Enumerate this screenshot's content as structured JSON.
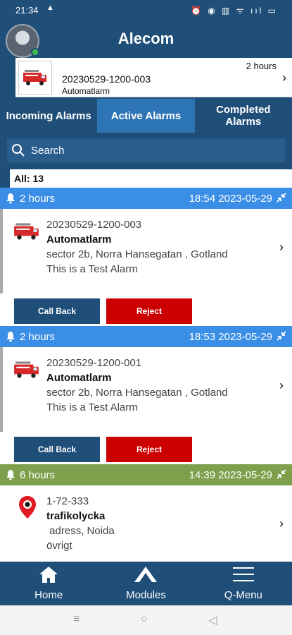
{
  "status": {
    "time": "21:34",
    "icons": "⏰ ◉ ▥ ᯤ ııl ▭"
  },
  "app": {
    "title": "Alecom"
  },
  "banner": {
    "id": "20230529-1200-003",
    "type": "Automatlarm",
    "time": "2 hours"
  },
  "tabs": [
    "Incoming Alarms",
    "Active Alarms",
    "Completed Alarms"
  ],
  "search": {
    "placeholder": "Search"
  },
  "count": "All: 13",
  "alarms": [
    {
      "age": "2 hours",
      "timestamp": "18:54 2023-05-29",
      "id": "20230529-1200-003",
      "type": "Automatlarm",
      "address": "sector 2b, Norra Hansegatan , Gotland",
      "note": "This is a Test Alarm",
      "header_color": "#3a8ee6",
      "icon": "fire-truck-icon",
      "call_label": "Call Back",
      "reject_label": "Reject"
    },
    {
      "age": "2 hours",
      "timestamp": "18:53 2023-05-29",
      "id": "20230529-1200-001",
      "type": "Automatlarm",
      "address": "sector 2b, Norra Hansegatan , Gotland",
      "note": "This is a Test Alarm",
      "header_color": "#3a8ee6",
      "icon": "fire-truck-icon",
      "call_label": "Call Back",
      "reject_label": "Reject"
    },
    {
      "age": "6 hours",
      "timestamp": "14:39 2023-05-29",
      "id": "1-72-333",
      "type": "trafikolycka",
      "address": " adress, Noida",
      "note": "övrigt",
      "header_color": "#7ea04d",
      "icon": "location-pin-icon"
    }
  ],
  "nav": {
    "home": "Home",
    "modules": "Modules",
    "qmenu": "Q-Menu"
  },
  "sysnav": {
    "recent": "≡",
    "home": "○",
    "back": "◁"
  }
}
